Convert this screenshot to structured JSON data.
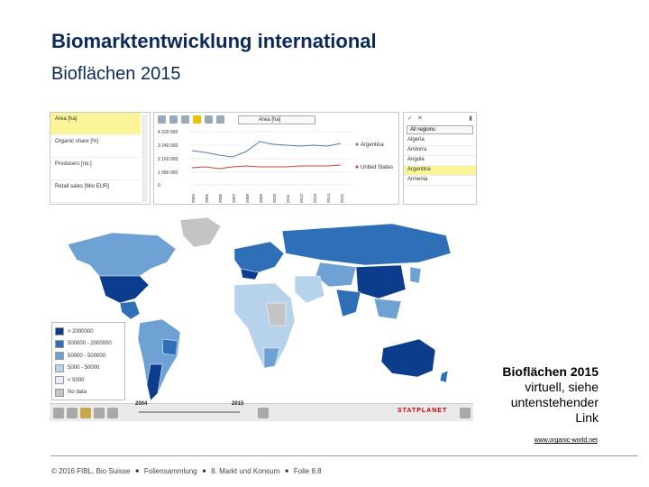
{
  "title": "Biomarktentwicklung international",
  "subtitle": "Bioflächen 2015",
  "indicators": [
    {
      "label": "Area [ha]",
      "selected": true
    },
    {
      "label": "Organic share [%]",
      "selected": false
    },
    {
      "label": "Producers [no.]",
      "selected": false
    },
    {
      "label": "Retail sales [Mio EUR]",
      "selected": false
    }
  ],
  "chart": {
    "dropdown": "Area [ha]",
    "y_ticks": [
      "4 320 000",
      "3 240 000",
      "2 160 000",
      "1 080 000",
      "0"
    ],
    "x_ticks": [
      "2004",
      "2005",
      "2006",
      "2007",
      "2008",
      "2009",
      "2010",
      "2011",
      "2012",
      "2013",
      "2014",
      "2015"
    ],
    "legend": [
      "Argentina",
      "United States"
    ]
  },
  "regions": {
    "dropdown": "All regions",
    "items": [
      "Algeria",
      "Andorra",
      "Angola",
      "Argentina",
      "Armenia"
    ],
    "selected": "Argentina"
  },
  "map_legend": [
    {
      "label": "> 2000000",
      "color": "#0b3d8c"
    },
    {
      "label": "500000 - 2000000",
      "color": "#2f6fb8"
    },
    {
      "label": "50000 - 500000",
      "color": "#6ea2d4"
    },
    {
      "label": "5000 - 50000",
      "color": "#b7d3ec"
    },
    {
      "label": "< 5000",
      "color": "#e3eef8"
    },
    {
      "label": "No data",
      "color": "#c4c4c4"
    }
  ],
  "timeline": {
    "start": "2004",
    "end": "2015"
  },
  "brand": "STATPLANET",
  "annotation": {
    "line1": "Bioflächen 2015",
    "line2": "virtuell, siehe",
    "line3": "untenstehender",
    "line4": "Link"
  },
  "link": "www.organic-world.net",
  "footer": [
    "© 2016 FIBL, Bio Suisse",
    "Foliensammlung",
    "8. Markt und Konsum",
    "Folie 8.8"
  ],
  "colors": {
    "title": "#0a2a5c",
    "highlight": "#fbf59a"
  }
}
